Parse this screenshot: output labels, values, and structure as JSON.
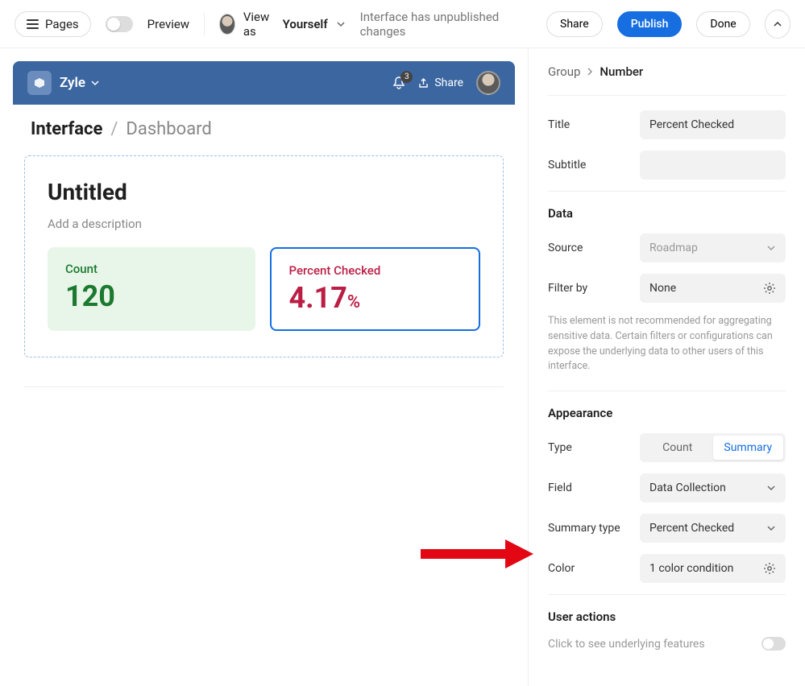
{
  "topbar": {
    "pages": "Pages",
    "preview": "Preview",
    "viewas_prefix": "View as ",
    "viewas_name": "Yourself",
    "status": "Interface has unpublished changes",
    "share": "Share",
    "publish": "Publish",
    "done": "Done"
  },
  "app": {
    "name": "Zyle",
    "notif_count": "3",
    "share": "Share"
  },
  "crumb": {
    "root": "Interface",
    "sep": "/",
    "leaf": "Dashboard"
  },
  "dash": {
    "title": "Untitled",
    "desc": "Add a description",
    "card1_label": "Count",
    "card1_value": "120",
    "card2_label": "Percent Checked",
    "card2_value": "4.17",
    "card2_unit": "%"
  },
  "panel": {
    "bc_parent": "Group",
    "bc_leaf": "Number",
    "title_label": "Title",
    "title_value": "Percent Checked",
    "subtitle_label": "Subtitle",
    "subtitle_value": "",
    "data_h": "Data",
    "source_label": "Source",
    "source_value": "Roadmap",
    "filter_label": "Filter by",
    "filter_value": "None",
    "note": "This element is not recommended for aggregating sensitive data. Certain filters or configurations can expose the underlying data to other users of this interface.",
    "appearance_h": "Appearance",
    "type_label": "Type",
    "type_opt1": "Count",
    "type_opt2": "Summary",
    "field_label": "Field",
    "field_value": "Data Collection",
    "summary_label": "Summary type",
    "summary_value": "Percent Checked",
    "color_label": "Color",
    "color_value": "1 color condition",
    "ua_h": "User actions",
    "ua_text": "Click to see underlying features"
  }
}
